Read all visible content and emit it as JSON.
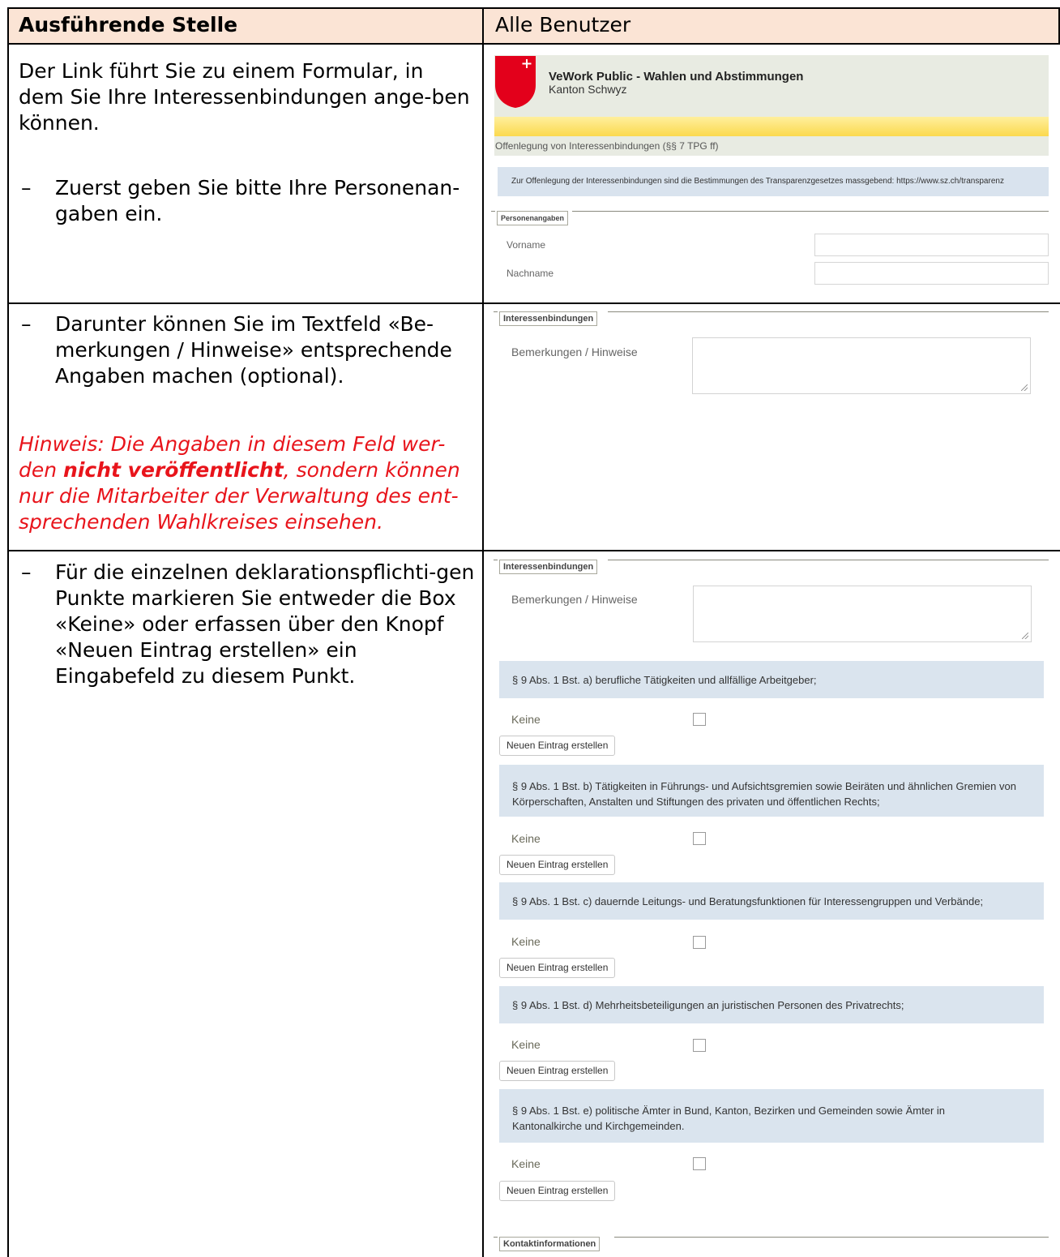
{
  "table": {
    "header": {
      "left": "Ausführende Stelle",
      "right": "Alle Benutzer"
    },
    "rows": [
      {
        "intro": "Der Link führt Sie zu einem Formular, in dem Sie Ihre Interessenbindungen ange-ben können.",
        "bullet": "–",
        "bullet_text": "Zuerst geben Sie bitte Ihre Personenan-gaben ein."
      },
      {
        "bullet": "–",
        "bullet_text": "Darunter können Sie im Textfeld «Be-merkungen / Hinweise» entsprechende Angaben machen (optional).",
        "note_pre": "Hinweis: Die Angaben in diesem Feld wer-den ",
        "note_bold": "nicht veröffentlicht",
        "note_post": ", sondern können nur die Mitarbeiter der Verwaltung des ent-sprechenden Wahlkreises einsehen."
      },
      {
        "bullet": "–",
        "bullet_text": "Für die einzelnen deklarationspflichti-gen Punkte markieren Sie entweder die Box «Keine» oder erfassen über den Knopf «Neuen Eintrag erstellen» ein Eingabefeld zu diesem Punkt."
      }
    ]
  },
  "app": {
    "title": "VeWork Public - Wahlen und Abstimmungen",
    "subtitle": "Kanton Schwyz",
    "breadcrumb": "Offenlegung von Interessenbindungen (§§ 7 TPG ff)",
    "info": "Zur Offenlegung der Interessenbindungen sind die Bestimmungen des Transparenzgesetzes massgebend: https://www.sz.ch/transparenz",
    "personen_legend": "Personenangaben",
    "vorname_label": "Vorname",
    "nachname_label": "Nachname",
    "interessen_legend": "Interessenbindungen",
    "bemerkungen_label": "Bemerkungen / Hinweise",
    "keine_label": "Keine",
    "new_entry_label": "Neuen Eintrag erstellen",
    "kontakt_legend": "Kontaktinformationen",
    "sections": [
      "§ 9 Abs. 1 Bst. a) berufliche Tätigkeiten und allfällige Arbeitgeber;",
      "§ 9 Abs. 1 Bst. b) Tätigkeiten in Führungs- und Aufsichtsgremien sowie Beiräten und ähnlichen Gremien von Körperschaften, Anstalten und Stiftungen des privaten und öffentlichen Rechts;",
      "§ 9 Abs. 1 Bst. c) dauernde Leitungs- und Beratungsfunktionen für Interessengruppen und Verbände;",
      "§ 9 Abs. 1 Bst. d) Mehrheitsbeteiligungen an juristischen Personen des Privatrechts;",
      "§ 9 Abs. 1 Bst. e) politische Ämter in Bund, Kanton, Bezirken und Gemeinden sowie Ämter in Kantonalkirche und Kirchgemeinden."
    ]
  },
  "colors": {
    "header_bg": "#fbe4d5",
    "note_red": "#e8141b",
    "shield_red": "#e3001b",
    "section_bg": "#dae4ee"
  },
  "icons": [
    "schwyz-coat-of-arms-icon",
    "resize-grip-icon",
    "checkbox-icon"
  ]
}
